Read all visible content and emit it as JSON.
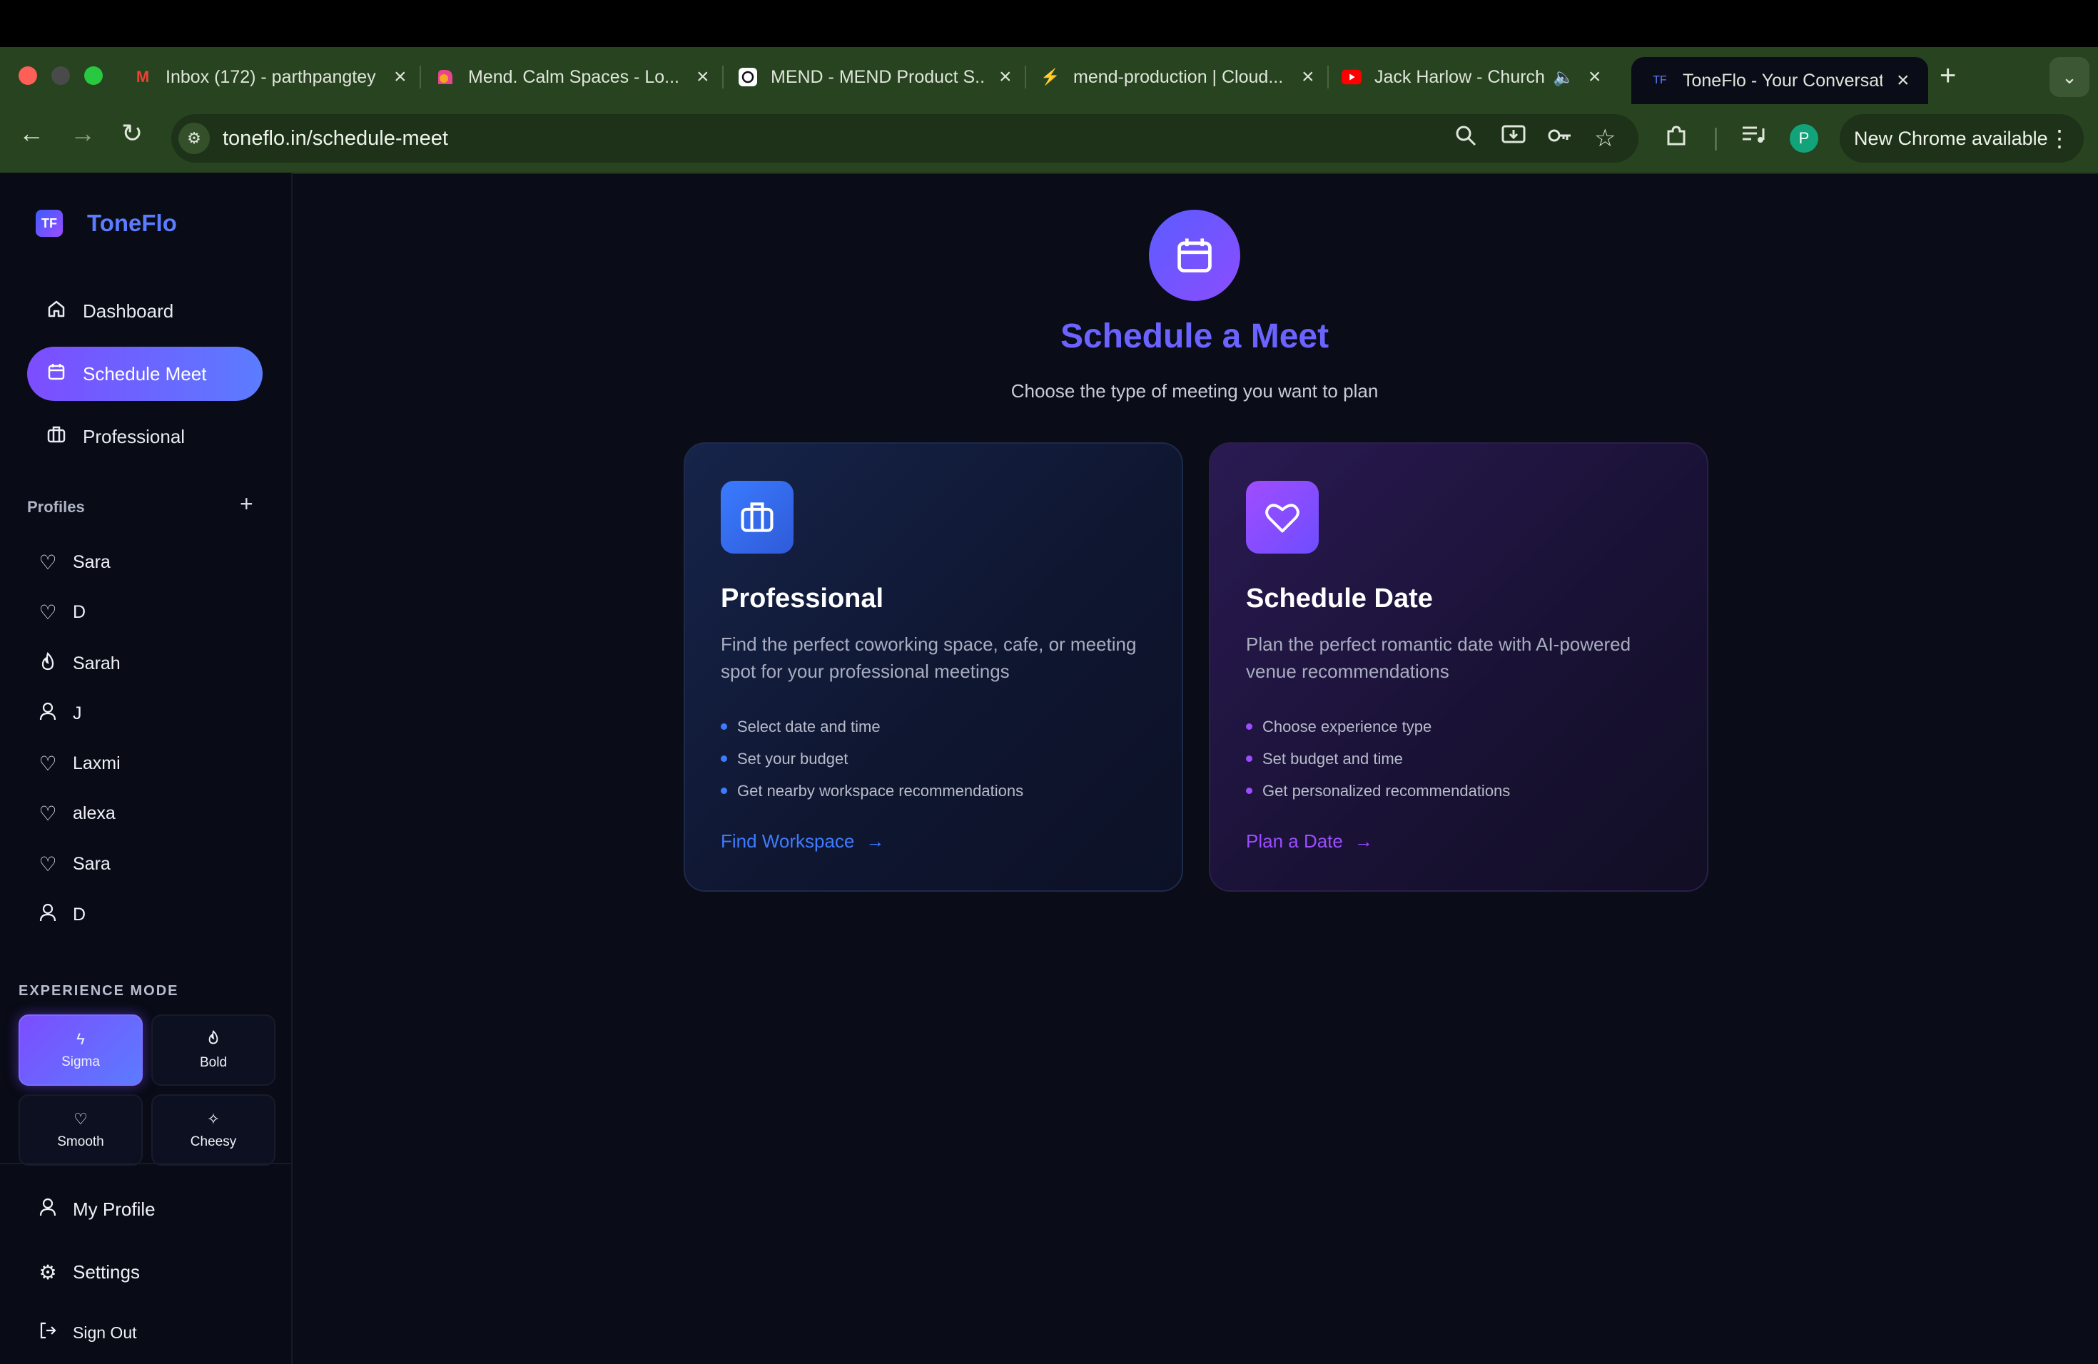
{
  "browser": {
    "tabs": [
      {
        "title": "Inbox (172) - parthpangtey",
        "favicon": "gmail-icon"
      },
      {
        "title": "Mend. Calm Spaces - Lo...",
        "favicon": "mend-icon"
      },
      {
        "title": "MEND - MEND Product S...",
        "favicon": "openai-icon"
      },
      {
        "title": "mend-production | Cloud...",
        "favicon": "bolt-icon"
      },
      {
        "title": "Jack Harlow - Church",
        "favicon": "youtube-icon"
      },
      {
        "title": "ToneFlo - Your Conversation",
        "favicon": "toneflo-icon"
      }
    ],
    "url": "toneflo.in/schedule-meet",
    "update_label": "New Chrome available",
    "profile_initial": "P"
  },
  "sidebar": {
    "brand": "ToneFlo",
    "logo_text": "TF",
    "nav": [
      {
        "label": "Dashboard",
        "icon": "home-icon"
      },
      {
        "label": "Schedule Meet",
        "icon": "calendar-icon"
      },
      {
        "label": "Professional",
        "icon": "briefcase-icon"
      }
    ],
    "profiles_heading": "Profiles",
    "profiles": [
      {
        "name": "Sara",
        "icon": "heart-icon"
      },
      {
        "name": "D",
        "icon": "heart-icon"
      },
      {
        "name": "Sarah",
        "icon": "flame-icon"
      },
      {
        "name": "J",
        "icon": "user-icon"
      },
      {
        "name": "Laxmi",
        "icon": "heart-icon"
      },
      {
        "name": "alexa",
        "icon": "heart-icon"
      },
      {
        "name": "Sara",
        "icon": "heart-icon"
      },
      {
        "name": "D",
        "icon": "user-icon"
      }
    ],
    "experience_heading": "EXPERIENCE MODE",
    "modes": [
      {
        "label": "Sigma",
        "icon": "bolt-icon",
        "active": true
      },
      {
        "label": "Bold",
        "icon": "flame-icon",
        "active": false
      },
      {
        "label": "Smooth",
        "icon": "heart-icon",
        "active": false
      },
      {
        "label": "Cheesy",
        "icon": "sparkles-icon",
        "active": false
      }
    ],
    "bottom": [
      {
        "label": "My Profile",
        "icon": "user-icon"
      },
      {
        "label": "Settings",
        "icon": "gear-icon"
      },
      {
        "label": "Sign Out",
        "icon": "sign-out-icon"
      }
    ]
  },
  "main": {
    "title": "Schedule a Meet",
    "subtitle": "Choose the type of meeting you want to plan",
    "cards": [
      {
        "title": "Professional",
        "icon": "briefcase-icon",
        "description": "Find the perfect coworking space, cafe, or meeting spot for your professional meetings",
        "features": [
          "Select date and time",
          "Set your budget",
          "Get nearby workspace recommendations"
        ],
        "cta": "Find Workspace"
      },
      {
        "title": "Schedule Date",
        "icon": "heart-icon",
        "description": "Plan the perfect romantic date with AI-powered venue recommendations",
        "features": [
          "Choose experience type",
          "Set budget and time",
          "Get personalized recommendations"
        ],
        "cta": "Plan a Date"
      }
    ]
  },
  "colors": {
    "accent_blue": "#5b7cff",
    "accent_purple": "#7c4dff",
    "title_purple": "#6b63ff",
    "link_blue": "#3f7bff",
    "link_purple": "#9b4dff"
  }
}
